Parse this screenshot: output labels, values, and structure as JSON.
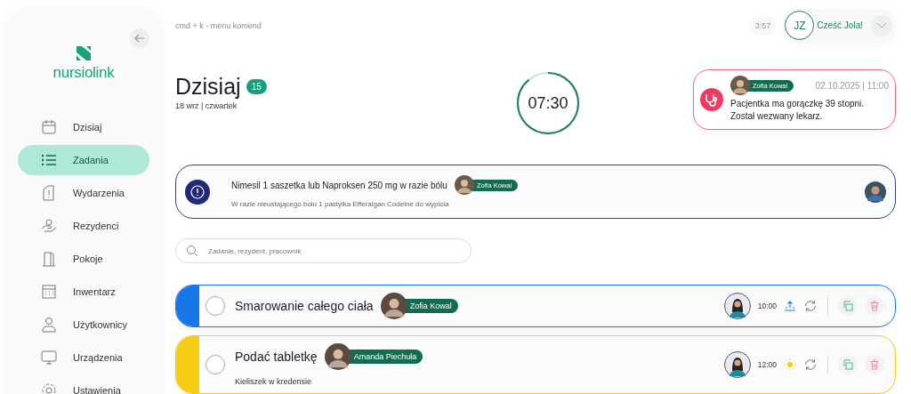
{
  "sidebar": {
    "logo": "nursiolink",
    "items": [
      {
        "label": "Dzisiaj",
        "selected": false
      },
      {
        "label": "Zadania",
        "selected": true
      },
      {
        "label": "Wydarzenia",
        "selected": false
      },
      {
        "label": "Rezydenci",
        "selected": false
      },
      {
        "label": "Pokoje",
        "selected": false
      },
      {
        "label": "Inwentarz",
        "selected": false
      },
      {
        "label": "Użytkownicy",
        "selected": false
      },
      {
        "label": "Urządzenia",
        "selected": false
      },
      {
        "label": "Ustawienia",
        "selected": false
      }
    ]
  },
  "header": {
    "hint": "cmd + k - menu komend",
    "timer": "3:57",
    "user_initials": "JZ",
    "greeting": "Cześć Jola!"
  },
  "page": {
    "title": "Dzisiaj",
    "count": "15",
    "date": "18 wrz | czwartek"
  },
  "clock": {
    "time": "07:30"
  },
  "alert": {
    "resident": "Zofia Kowal",
    "datetime": "02.10.2025 | 11:00",
    "lines": [
      "Pacjentka ma gorączkę  39 stopni.",
      "Został wezwany lekarz."
    ]
  },
  "note": {
    "title": "Nimesil 1 saszetka lub Naproksen 250 mg w razie bólu",
    "resident": "Zofia Kowal",
    "detail": "W razie nieustającego bolu 1 pastylka Efferalgan Codeine do wypicia"
  },
  "search": {
    "placeholder": "Zadanie, rezydent, pracownik"
  },
  "tasks": [
    {
      "title": "Smarowanie całego ciała",
      "resident": "Zofia Kowal",
      "time": "10:00",
      "kind": "sunrise",
      "color": "#1877e8",
      "checked": false
    },
    {
      "title": "Podać tabletkę",
      "resident": "Amanda Piechuła",
      "detail": "Kieliszek w kredensie",
      "time": "12:00",
      "kind": "sun",
      "color": "#f6cc14",
      "checked": false
    }
  ]
}
